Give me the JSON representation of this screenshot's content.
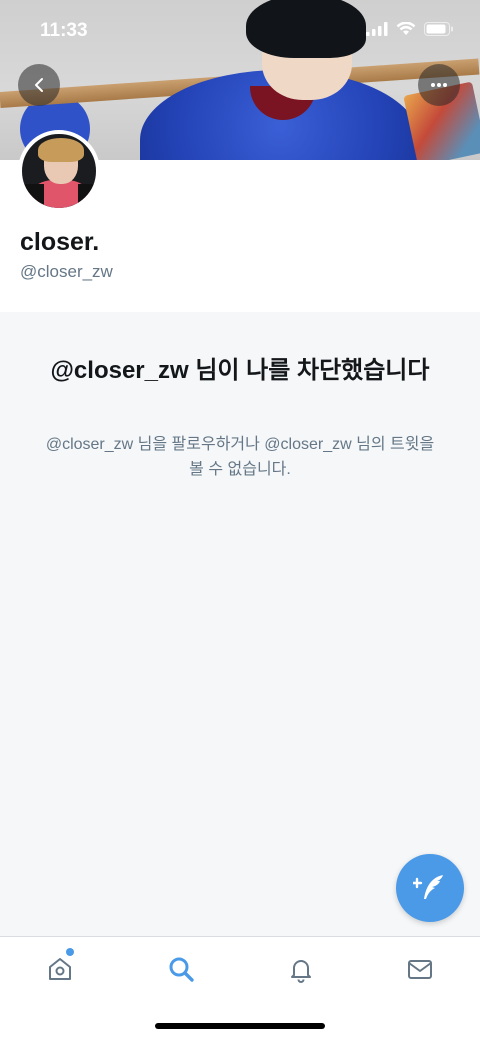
{
  "status_bar": {
    "time": "11:33"
  },
  "header": {
    "back_icon": "chevron-left-icon",
    "more_icon": "more-horizontal-icon"
  },
  "profile": {
    "display_name": "closer.",
    "handle": "@closer_zw"
  },
  "blocked": {
    "title": "@closer_zw 님이 나를 차단했습니다",
    "description": "@closer_zw 님을 팔로우하거나 @closer_zw 님의 트윗을 볼 수 없습니다."
  },
  "fab": {
    "icon": "compose-feather-icon"
  },
  "tabs": [
    {
      "name": "home",
      "icon": "home-icon",
      "active": false,
      "has_dot": true
    },
    {
      "name": "search",
      "icon": "search-icon",
      "active": true
    },
    {
      "name": "notifications",
      "icon": "bell-icon",
      "active": false
    },
    {
      "name": "messages",
      "icon": "mail-icon",
      "active": false
    }
  ],
  "colors": {
    "accent": "#4a9ae8",
    "muted": "#657786",
    "text": "#14171a",
    "background_alt": "#f5f7f9"
  }
}
